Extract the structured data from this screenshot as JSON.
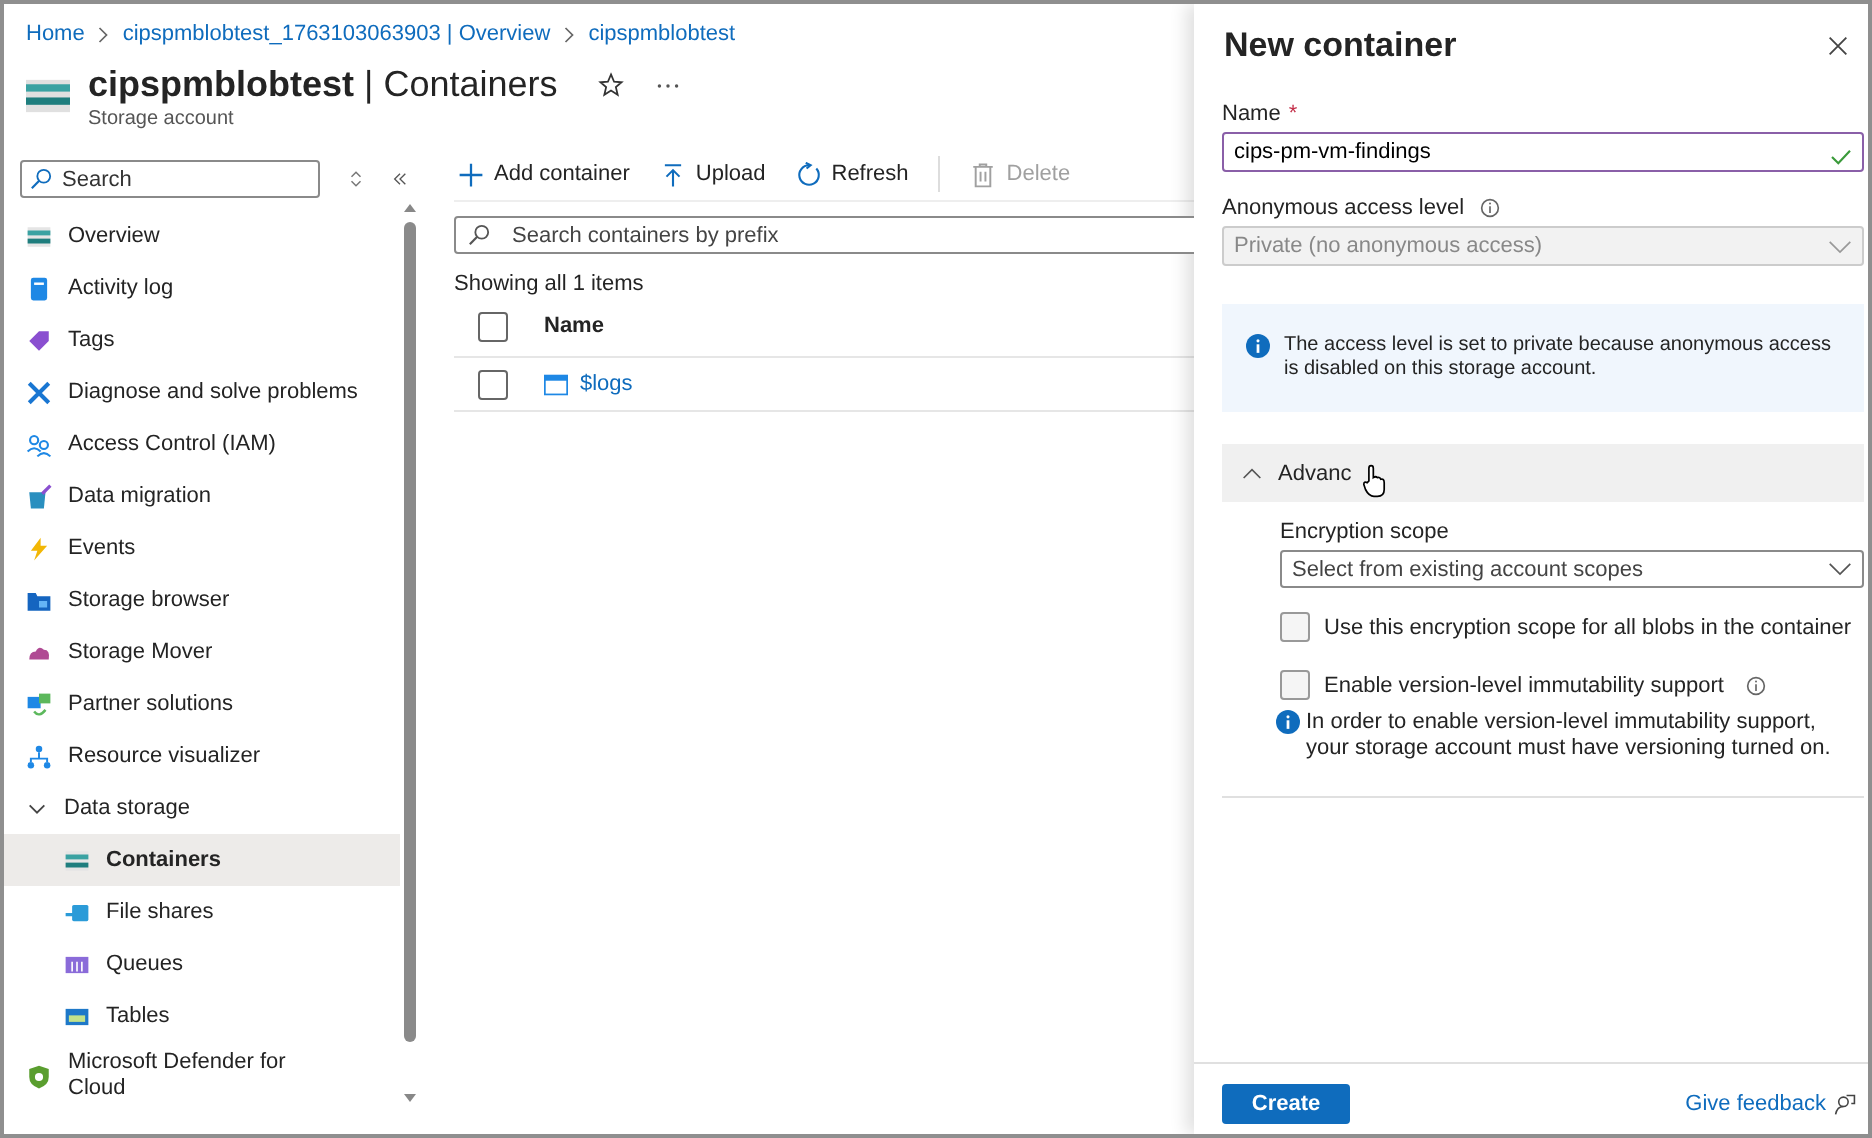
{
  "breadcrumb": [
    "Home",
    "cipspmblobtest_1763103063903 | Overview",
    "cipspmblobtest"
  ],
  "page": {
    "title": "**cipspmblobtest** | Containers",
    "subtitle": "Storage account"
  },
  "sidebar": {
    "search_placeholder": "Search",
    "items": [
      {
        "label": "Overview",
        "selected": false
      },
      {
        "label": "Activity log",
        "selected": false
      },
      {
        "label": "Tags",
        "selected": false
      },
      {
        "label": "Diagnose and solve problems",
        "selected": false
      },
      {
        "label": "Access Control (IAM)",
        "selected": false
      },
      {
        "label": "Data migration",
        "selected": false
      },
      {
        "label": "Events",
        "selected": false
      },
      {
        "label": "Storage browser",
        "selected": false
      },
      {
        "label": "Storage Mover",
        "selected": false
      },
      {
        "label": "Partner solutions",
        "selected": false
      },
      {
        "label": "Resource visualizer",
        "selected": false
      },
      {
        "label": "Data storage",
        "selected": false,
        "expanded": true,
        "children": [
          {
            "label": "Containers",
            "selected": true
          },
          {
            "label": "File shares",
            "selected": false
          },
          {
            "label": "Queues",
            "selected": false
          },
          {
            "label": "Tables",
            "selected": false
          }
        ]
      },
      {
        "label": "Microsoft Defender for Cloud",
        "selected": false
      }
    ]
  },
  "toolbar": [
    {
      "label": "Add container",
      "disabled": false
    },
    {
      "label": "Upload",
      "disabled": false
    },
    {
      "label": "Refresh",
      "disabled": false
    },
    {
      "label": "Delete",
      "disabled": true
    }
  ],
  "search": {
    "placeholder": "Search containers by prefix"
  },
  "summary": "Showing all 1 items",
  "table": {
    "columns": [
      "Name"
    ],
    "all_checked": false,
    "rows": [
      {
        "name": "$logs",
        "checked": false
      }
    ]
  },
  "panel": {
    "title": "New container",
    "name_label": "Name",
    "required_mark": "*",
    "name_value": "cips-pm-vm-findings",
    "valid": true,
    "access_label": "Anonymous access level",
    "access_value": "Private (no anonymous access)",
    "access_disabled": true,
    "info": "The access level is set to private because anonymous access is disabled on this storage account.",
    "advanced": {
      "label": "Advanc",
      "expanded": true
    },
    "encryption_label": "Encryption scope",
    "encryption_placeholder": "Select from existing account scopes",
    "options": [
      {
        "label": "Use this encryption scope for all blobs in the container",
        "checked": false,
        "info_icon": false
      },
      {
        "label": "Enable version-level immutability support",
        "checked": false,
        "info_icon": true
      }
    ],
    "note": "In order to enable version-level immutability support, your storage account must have versioning turned on.",
    "create": "Create",
    "feedback": "Give feedback"
  }
}
